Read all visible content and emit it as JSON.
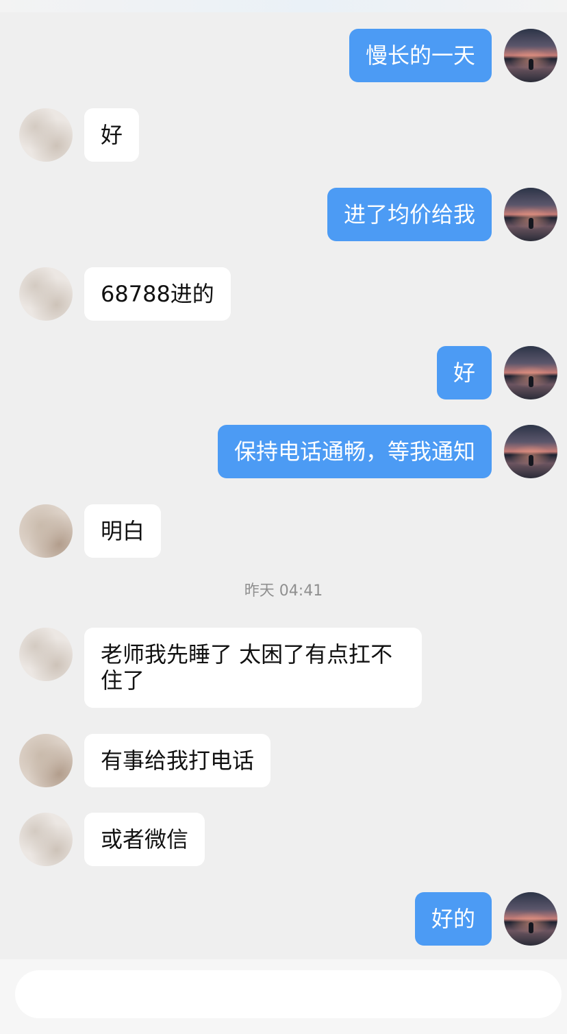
{
  "timestamp": "昨天 04:41",
  "input": {
    "placeholder": ""
  },
  "messages": [
    {
      "from": "me",
      "text": "慢长的一天"
    },
    {
      "from": "them",
      "text": "好"
    },
    {
      "from": "me",
      "text": "进了均价给我"
    },
    {
      "from": "them",
      "text": "68788进的"
    },
    {
      "from": "me",
      "text": "好"
    },
    {
      "from": "me",
      "text": "保持电话通畅，等我通知"
    },
    {
      "from": "them",
      "text": "明白"
    },
    {
      "from": "them",
      "text": "老师我先睡了 太困了有点扛不住了"
    },
    {
      "from": "them",
      "text": "有事给我打电话"
    },
    {
      "from": "them",
      "text": "或者微信"
    },
    {
      "from": "me",
      "text": "好的"
    }
  ],
  "colors": {
    "background": "#efefef",
    "outgoing_bubble": "#4c9bf4",
    "incoming_bubble": "#ffffff",
    "timestamp_text": "#8f8f8f"
  }
}
